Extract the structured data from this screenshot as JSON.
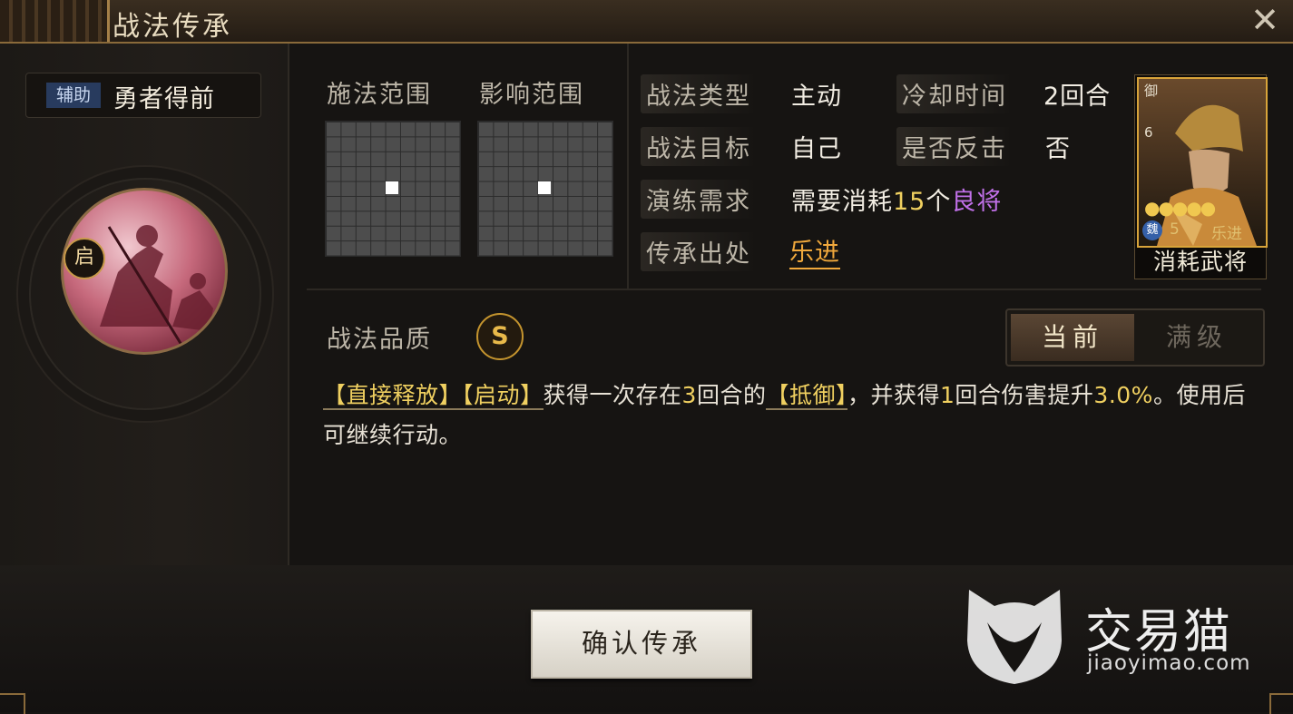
{
  "window": {
    "title": "战法传承"
  },
  "skill": {
    "category_tag": "辅助",
    "name": "勇者得前",
    "icon_badge": "启"
  },
  "ranges": {
    "cast_label": "施法范围",
    "effect_label": "影响范围"
  },
  "info": {
    "type_label": "战法类型",
    "type_value": "主动",
    "cooldown_label": "冷却时间",
    "cooldown_value": "2回合",
    "target_label": "战法目标",
    "target_value": "自己",
    "counter_label": "是否反击",
    "counter_value": "否",
    "drill_label": "演练需求",
    "drill_prefix": "需要消耗",
    "drill_count": "15",
    "drill_unit": "个",
    "drill_item": "良将",
    "origin_label": "传承出处",
    "origin_value": "乐进"
  },
  "card": {
    "type": "御",
    "cost": "6",
    "stars": "●●●●●",
    "faction": "魏",
    "level": "5",
    "name": "乐进",
    "footer": "消耗武将"
  },
  "quality": {
    "label": "战法品质",
    "grade": "S"
  },
  "level_toggle": {
    "current": "当前",
    "max": "满级"
  },
  "description": {
    "tag1": "【直接释放】",
    "tag2": "【启动】",
    "text1": "获得一次存在",
    "num1": "3",
    "text2": "回合的",
    "tag3": "【抵御】",
    "text3": "，并获得",
    "num2": "1",
    "text4": "回合伤害提升",
    "num3": "3.0%",
    "text5": "。使用后可继续行动。"
  },
  "footer": {
    "confirm": "确认传承"
  },
  "watermark": {
    "title": "交易猫",
    "url": "jiaoyimao.com"
  },
  "colors": {
    "accent_gold": "#f0d060",
    "link_orange": "#f0a83c",
    "item_purple": "#c070e8"
  }
}
